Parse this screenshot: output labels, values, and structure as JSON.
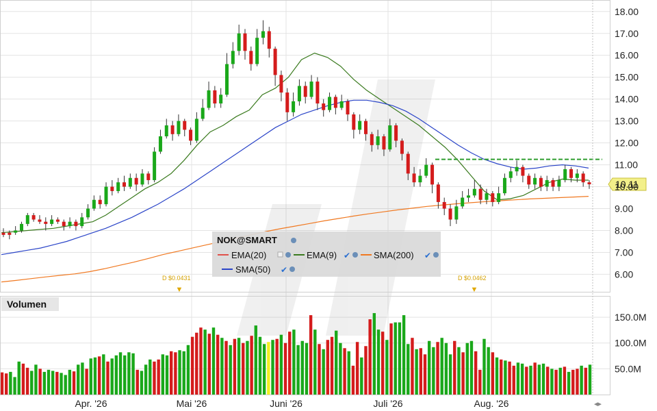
{
  "legend": {
    "symbol": "NOK@SMART",
    "items": [
      {
        "label": "EMA(20)",
        "color": "#e0504a"
      },
      {
        "label": "EMA(9)",
        "color": "#3a7a1e"
      },
      {
        "label": "SMA(200)",
        "color": "#f07820"
      },
      {
        "label": "SMA(50)",
        "color": "#2a44c8"
      }
    ]
  },
  "dividends": [
    {
      "label": "D $0.0431",
      "month_index": 1.1
    },
    {
      "label": "D $0.0462",
      "month_index": 4.0
    }
  ],
  "volume_label": "Volumen",
  "last_price_label": "10.11",
  "colors": {
    "up": "#1aa81a",
    "down": "#d41c1c",
    "highlight": "#f0f020",
    "grid": "#e3e3e3",
    "price_tag": "#f3f08a"
  },
  "chart_data": {
    "type": "candlestick",
    "x_labels": [
      "Apr. '26",
      "Mai '26",
      "Juni '26",
      "Juli '26",
      "Aug. '26"
    ],
    "price_axis": {
      "ticks": [
        "6.00",
        "7.00",
        "8.00",
        "9.00",
        "10.00",
        "11.00",
        "12.00",
        "13.00",
        "14.00",
        "15.00",
        "16.00",
        "17.00",
        "18.00"
      ],
      "ylim": [
        5.2,
        18.4
      ]
    },
    "volume_axis": {
      "ticks": [
        "50.0M",
        "100.0M",
        "150.0M"
      ],
      "ylim": [
        0,
        190
      ]
    },
    "last_price": 10.11,
    "resistance_level": 11.25,
    "series": [
      {
        "name": "EMA(9)",
        "values": [
          7.9,
          7.95,
          8.0,
          8.05,
          8.1,
          8.2,
          8.3,
          8.4,
          8.7,
          9.1,
          9.5,
          9.9,
          10.2,
          10.6,
          11.2,
          11.9,
          12.5,
          12.8,
          13.2,
          13.5,
          14.2,
          14.5,
          15.0,
          15.8,
          16.1,
          15.9,
          15.5,
          14.9,
          14.4,
          14.0,
          13.6,
          13.2,
          12.8,
          12.3,
          11.8,
          11.2,
          10.5,
          9.8,
          9.4,
          9.45,
          9.6,
          9.9,
          10.2,
          10.35,
          10.3,
          10.3
        ]
      },
      {
        "name": "SMA(50)",
        "values": [
          6.9,
          7.0,
          7.1,
          7.2,
          7.35,
          7.5,
          7.7,
          7.9,
          8.1,
          8.35,
          8.6,
          8.9,
          9.2,
          9.55,
          9.9,
          10.3,
          10.7,
          11.1,
          11.5,
          11.9,
          12.3,
          12.7,
          13.0,
          13.3,
          13.5,
          13.7,
          13.85,
          13.95,
          13.95,
          13.85,
          13.7,
          13.45,
          13.1,
          12.7,
          12.3,
          11.9,
          11.55,
          11.25,
          11.05,
          10.9,
          10.8,
          10.85,
          10.95,
          11.0,
          10.95,
          10.85
        ]
      },
      {
        "name": "SMA(200)",
        "values": [
          5.65,
          5.72,
          5.8,
          5.88,
          5.95,
          6.02,
          6.12,
          6.25,
          6.4,
          6.55,
          6.72,
          6.9,
          7.05,
          7.2,
          7.35,
          7.5,
          7.65,
          7.8,
          7.95,
          8.08,
          8.2,
          8.32,
          8.44,
          8.55,
          8.66,
          8.76,
          8.85,
          8.94,
          9.02,
          9.1,
          9.16,
          9.22,
          9.27,
          9.32,
          9.36,
          9.4,
          9.44,
          9.47,
          9.5,
          9.53,
          9.56
        ]
      }
    ],
    "candles": [
      [
        7.9,
        7.8,
        8.1,
        7.7,
        0
      ],
      [
        7.8,
        7.9,
        8.0,
        7.6,
        0
      ],
      [
        7.9,
        8.0,
        8.2,
        7.8,
        1
      ],
      [
        8.0,
        8.3,
        8.4,
        7.9,
        1
      ],
      [
        8.3,
        8.7,
        8.8,
        8.2,
        1
      ],
      [
        8.7,
        8.5,
        8.8,
        8.4,
        0
      ],
      [
        8.5,
        8.4,
        8.7,
        8.3,
        0
      ],
      [
        8.4,
        8.3,
        8.6,
        8.0,
        0
      ],
      [
        8.3,
        8.5,
        8.7,
        8.2,
        1
      ],
      [
        8.5,
        8.4,
        8.6,
        8.3,
        0
      ],
      [
        8.4,
        8.2,
        8.5,
        8.0,
        0
      ],
      [
        8.2,
        8.4,
        8.6,
        8.1,
        1
      ],
      [
        8.4,
        8.2,
        8.5,
        8.0,
        0
      ],
      [
        8.2,
        8.6,
        8.8,
        8.1,
        1
      ],
      [
        8.6,
        9.0,
        9.2,
        8.5,
        1
      ],
      [
        9.0,
        9.4,
        9.6,
        8.9,
        1
      ],
      [
        9.4,
        9.2,
        9.6,
        9.0,
        0
      ],
      [
        9.2,
        10.0,
        10.2,
        9.1,
        1
      ],
      [
        10.0,
        9.8,
        10.3,
        9.6,
        0
      ],
      [
        9.8,
        10.2,
        10.4,
        9.7,
        1
      ],
      [
        10.2,
        10.0,
        10.5,
        9.8,
        0
      ],
      [
        10.0,
        10.4,
        10.6,
        9.9,
        1
      ],
      [
        10.4,
        10.1,
        10.6,
        9.8,
        0
      ],
      [
        10.1,
        10.6,
        10.8,
        10.0,
        1
      ],
      [
        10.6,
        10.3,
        10.7,
        10.1,
        0
      ],
      [
        10.3,
        11.6,
        11.8,
        10.2,
        1
      ],
      [
        11.6,
        12.3,
        12.6,
        11.5,
        1
      ],
      [
        12.3,
        12.8,
        13.1,
        12.2,
        1
      ],
      [
        12.8,
        12.4,
        13.0,
        12.1,
        0
      ],
      [
        12.4,
        13.0,
        13.3,
        12.3,
        1
      ],
      [
        13.0,
        12.6,
        13.1,
        12.3,
        0
      ],
      [
        12.6,
        12.1,
        12.7,
        11.9,
        0
      ],
      [
        12.1,
        13.1,
        13.4,
        12.0,
        1
      ],
      [
        13.1,
        13.6,
        14.0,
        13.0,
        1
      ],
      [
        13.6,
        14.4,
        14.8,
        13.5,
        1
      ],
      [
        14.4,
        13.8,
        14.6,
        13.6,
        0
      ],
      [
        13.8,
        14.2,
        14.5,
        13.6,
        1
      ],
      [
        14.2,
        15.6,
        16.1,
        14.1,
        1
      ],
      [
        15.6,
        16.2,
        16.6,
        15.4,
        1
      ],
      [
        16.2,
        17.0,
        17.4,
        16.0,
        1
      ],
      [
        17.0,
        16.2,
        17.2,
        15.8,
        0
      ],
      [
        16.2,
        15.6,
        16.4,
        15.3,
        0
      ],
      [
        15.6,
        16.8,
        17.2,
        15.5,
        1
      ],
      [
        16.8,
        17.1,
        17.6,
        16.5,
        1
      ],
      [
        17.1,
        16.3,
        17.3,
        15.9,
        0
      ],
      [
        16.3,
        15.1,
        16.4,
        14.6,
        0
      ],
      [
        15.1,
        14.3,
        15.3,
        13.9,
        0
      ],
      [
        14.3,
        13.4,
        14.5,
        13.0,
        0
      ],
      [
        13.4,
        13.9,
        14.3,
        13.2,
        1
      ],
      [
        13.9,
        14.6,
        14.9,
        13.7,
        1
      ],
      [
        14.6,
        14.1,
        14.8,
        13.8,
        0
      ],
      [
        14.1,
        14.8,
        15.1,
        14.0,
        1
      ],
      [
        14.8,
        13.8,
        15.0,
        13.5,
        0
      ],
      [
        13.8,
        13.5,
        14.0,
        13.2,
        0
      ],
      [
        13.5,
        14.1,
        14.3,
        13.4,
        1
      ],
      [
        14.1,
        13.6,
        14.2,
        13.3,
        0
      ],
      [
        13.6,
        13.9,
        14.2,
        13.5,
        1
      ],
      [
        13.9,
        13.3,
        14.0,
        13.0,
        0
      ],
      [
        13.3,
        12.6,
        13.4,
        12.2,
        0
      ],
      [
        12.6,
        13.0,
        13.3,
        12.4,
        1
      ],
      [
        13.0,
        12.4,
        13.1,
        12.1,
        0
      ],
      [
        12.4,
        11.9,
        12.5,
        11.6,
        0
      ],
      [
        11.9,
        12.3,
        12.6,
        11.7,
        1
      ],
      [
        12.3,
        11.7,
        12.4,
        11.4,
        0
      ],
      [
        11.7,
        12.8,
        13.1,
        11.6,
        1
      ],
      [
        12.8,
        12.1,
        12.9,
        11.8,
        0
      ],
      [
        12.1,
        11.5,
        12.2,
        11.2,
        0
      ],
      [
        11.5,
        10.6,
        11.6,
        10.3,
        0
      ],
      [
        10.6,
        10.2,
        10.9,
        10.0,
        0
      ],
      [
        10.2,
        10.5,
        10.8,
        10.0,
        1
      ],
      [
        10.5,
        11.0,
        11.3,
        10.4,
        1
      ],
      [
        11.0,
        10.1,
        11.1,
        9.7,
        0
      ],
      [
        10.1,
        9.3,
        10.2,
        9.0,
        0
      ],
      [
        9.3,
        9.0,
        9.5,
        8.7,
        0
      ],
      [
        9.0,
        8.5,
        9.2,
        8.2,
        0
      ],
      [
        8.5,
        9.1,
        9.4,
        8.3,
        1
      ],
      [
        9.1,
        9.5,
        9.8,
        9.0,
        1
      ],
      [
        9.5,
        9.6,
        9.9,
        9.3,
        1
      ],
      [
        9.6,
        9.9,
        10.3,
        9.5,
        1
      ],
      [
        9.9,
        9.4,
        10.1,
        9.2,
        0
      ],
      [
        9.4,
        9.7,
        9.9,
        9.2,
        1
      ],
      [
        9.7,
        9.3,
        9.8,
        9.1,
        0
      ],
      [
        9.3,
        9.7,
        10.0,
        9.2,
        1
      ],
      [
        9.7,
        10.4,
        10.6,
        9.6,
        1
      ],
      [
        10.4,
        10.7,
        10.9,
        10.2,
        1
      ],
      [
        10.7,
        10.9,
        11.2,
        10.5,
        1
      ],
      [
        10.9,
        10.5,
        11.0,
        10.2,
        0
      ],
      [
        10.5,
        10.1,
        10.6,
        9.9,
        0
      ],
      [
        10.1,
        10.4,
        10.6,
        9.9,
        1
      ],
      [
        10.4,
        10.0,
        10.5,
        9.8,
        0
      ],
      [
        10.0,
        10.3,
        10.5,
        9.8,
        1
      ],
      [
        10.3,
        10.0,
        10.4,
        9.8,
        0
      ],
      [
        10.0,
        10.3,
        10.5,
        9.8,
        1
      ],
      [
        10.3,
        10.8,
        11.0,
        10.2,
        1
      ],
      [
        10.8,
        10.4,
        10.9,
        10.2,
        0
      ],
      [
        10.4,
        10.6,
        10.8,
        10.2,
        1
      ],
      [
        10.6,
        10.2,
        10.7,
        10.0,
        0
      ],
      [
        10.2,
        10.11,
        10.3,
        9.9,
        0
      ]
    ],
    "volumes": [
      [
        43,
        0
      ],
      [
        41,
        0
      ],
      [
        44,
        1
      ],
      [
        34,
        1
      ],
      [
        64,
        1
      ],
      [
        60,
        0
      ],
      [
        52,
        0
      ],
      [
        46,
        1
      ],
      [
        58,
        1
      ],
      [
        50,
        0
      ],
      [
        44,
        1
      ],
      [
        48,
        1
      ],
      [
        46,
        1
      ],
      [
        44,
        0
      ],
      [
        42,
        1
      ],
      [
        38,
        1
      ],
      [
        48,
        1
      ],
      [
        45,
        0
      ],
      [
        58,
        1
      ],
      [
        62,
        1
      ],
      [
        50,
        0
      ],
      [
        70,
        1
      ],
      [
        72,
        1
      ],
      [
        74,
        0
      ],
      [
        78,
        1
      ],
      [
        64,
        0
      ],
      [
        70,
        1
      ],
      [
        76,
        1
      ],
      [
        82,
        1
      ],
      [
        76,
        1
      ],
      [
        82,
        1
      ],
      [
        80,
        1
      ],
      [
        48,
        0
      ],
      [
        46,
        1
      ],
      [
        58,
        1
      ],
      [
        68,
        1
      ],
      [
        64,
        0
      ],
      [
        68,
        0
      ],
      [
        78,
        1
      ],
      [
        76,
        1
      ],
      [
        84,
        0
      ],
      [
        82,
        0
      ],
      [
        86,
        1
      ],
      [
        84,
        1
      ],
      [
        96,
        1
      ],
      [
        112,
        0
      ],
      [
        120,
        0
      ],
      [
        130,
        0
      ],
      [
        126,
        1
      ],
      [
        118,
        0
      ],
      [
        130,
        1
      ],
      [
        116,
        0
      ],
      [
        110,
        1
      ],
      [
        104,
        0
      ],
      [
        96,
        1
      ],
      [
        108,
        0
      ],
      [
        110,
        1
      ],
      [
        100,
        0
      ],
      [
        104,
        1
      ],
      [
        114,
        0
      ],
      [
        134,
        1
      ],
      [
        112,
        1
      ],
      [
        98,
        1
      ],
      [
        102,
        0
      ],
      [
        106,
        1
      ],
      [
        108,
        0
      ],
      [
        116,
        1
      ],
      [
        100,
        0
      ],
      [
        122,
        0
      ],
      [
        126,
        1
      ],
      [
        96,
        1
      ],
      [
        104,
        1
      ],
      [
        100,
        1
      ],
      [
        154,
        0
      ],
      [
        126,
        1
      ],
      [
        98,
        0
      ],
      [
        88,
        1
      ],
      [
        106,
        0
      ],
      [
        112,
        0
      ],
      [
        124,
        1
      ],
      [
        100,
        1
      ],
      [
        90,
        0
      ],
      [
        84,
        1
      ],
      [
        56,
        0
      ],
      [
        102,
        0
      ],
      [
        72,
        1
      ],
      [
        94,
        0
      ],
      [
        146,
        0
      ],
      [
        158,
        1
      ],
      [
        126,
        1
      ],
      [
        122,
        0
      ],
      [
        106,
        1
      ],
      [
        138,
        0
      ],
      [
        140,
        1
      ],
      [
        140,
        1
      ],
      [
        154,
        1
      ],
      [
        98,
        1
      ],
      [
        110,
        0
      ],
      [
        88,
        1
      ],
      [
        90,
        0
      ],
      [
        78,
        0
      ],
      [
        104,
        1
      ],
      [
        92,
        1
      ],
      [
        102,
        0
      ],
      [
        110,
        1
      ],
      [
        100,
        1
      ],
      [
        78,
        1
      ],
      [
        104,
        0
      ],
      [
        92,
        1
      ],
      [
        82,
        0
      ],
      [
        100,
        1
      ],
      [
        104,
        1
      ],
      [
        84,
        0
      ],
      [
        48,
        0
      ],
      [
        108,
        1
      ],
      [
        92,
        1
      ],
      [
        82,
        0
      ],
      [
        72,
        1
      ],
      [
        68,
        0
      ],
      [
        66,
        1
      ],
      [
        64,
        0
      ],
      [
        56,
        0
      ],
      [
        62,
        1
      ],
      [
        60,
        1
      ],
      [
        54,
        0
      ],
      [
        56,
        1
      ],
      [
        62,
        0
      ],
      [
        58,
        1
      ],
      [
        60,
        1
      ],
      [
        54,
        0
      ],
      [
        50,
        1
      ],
      [
        48,
        0
      ],
      [
        52,
        1
      ],
      [
        54,
        0
      ],
      [
        44,
        1
      ],
      [
        48,
        0
      ],
      [
        50,
        0
      ],
      [
        56,
        1
      ],
      [
        52,
        0
      ],
      [
        58,
        1
      ]
    ]
  }
}
